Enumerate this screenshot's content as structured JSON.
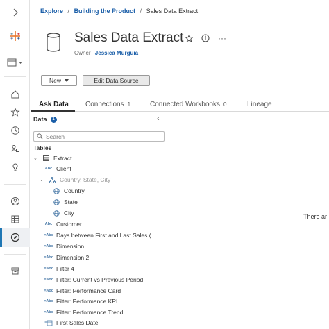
{
  "breadcrumb": {
    "items": [
      "Explore",
      "Building the Product"
    ],
    "separator": "/",
    "current": "Sales Data Extract"
  },
  "header": {
    "title": "Sales Data Extract",
    "owner_label": "Owner",
    "owner_name": "Jessica Murguia",
    "more_label": "···"
  },
  "actions": {
    "new_label": "New",
    "edit_label": "Edit Data Source"
  },
  "tabs": [
    {
      "label": "Ask Data",
      "count": ""
    },
    {
      "label": "Connections",
      "count": "1"
    },
    {
      "label": "Connected Workbooks",
      "count": "0"
    },
    {
      "label": "Lineage",
      "count": ""
    }
  ],
  "data_pane": {
    "title": "Data",
    "info": "1",
    "collapse": "‹",
    "search_placeholder": "Search",
    "tables_label": "Tables",
    "extract_label": "Extract",
    "fields": [
      {
        "label": "Client",
        "type": "Abc"
      },
      {
        "label": "Country, State, City",
        "type": "hierarchy"
      },
      {
        "label": "Country",
        "type": "geo"
      },
      {
        "label": "State",
        "type": "geo"
      },
      {
        "label": "City",
        "type": "geo"
      },
      {
        "label": "Customer",
        "type": "Abc"
      },
      {
        "label": "Days between First and Last Sales (...",
        "type": "=Abc"
      },
      {
        "label": "Dimension",
        "type": "=Abc"
      },
      {
        "label": "Dimension 2",
        "type": "=Abc"
      },
      {
        "label": "Filter 4",
        "type": "=Abc"
      },
      {
        "label": "Filter: Current vs Previous Period",
        "type": "=Abc"
      },
      {
        "label": "Filter: Performance Card",
        "type": "=Abc"
      },
      {
        "label": "Filter: Performance KPI",
        "type": "=Abc"
      },
      {
        "label": "Filter: Performance Trend",
        "type": "=Abc"
      },
      {
        "label": "First Sales Date",
        "type": "=date"
      }
    ]
  },
  "main": {
    "empty_text": "There ar"
  },
  "colors": {
    "link": "#1a5ea8",
    "accent": "#1f77b4"
  }
}
